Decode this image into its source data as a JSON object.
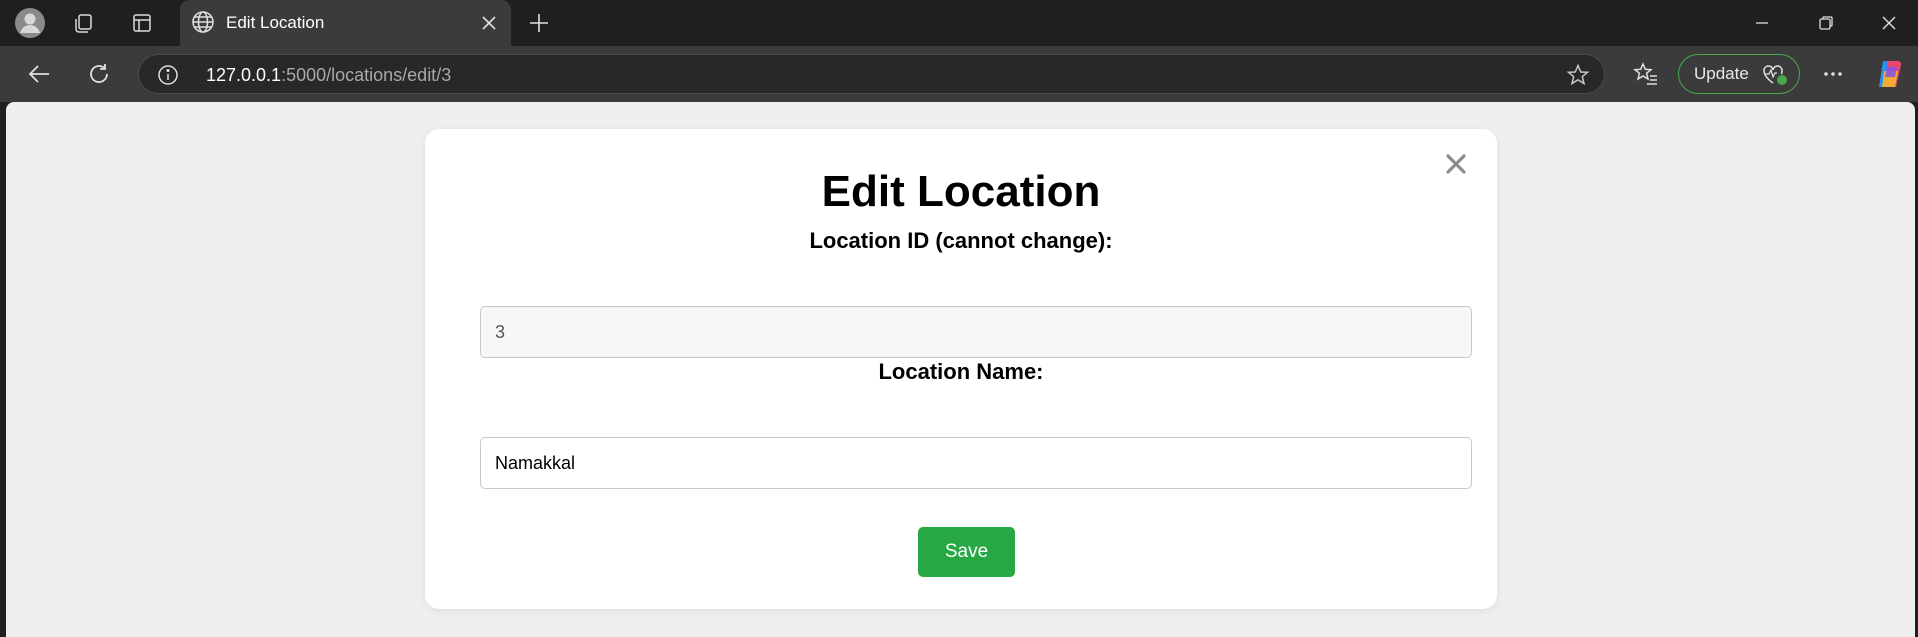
{
  "browser": {
    "tab": {
      "title": "Edit Location"
    },
    "address": {
      "host": "127.0.0.1",
      "path": ":5000/locations/edit/3"
    },
    "update_label": "Update",
    "icons": [
      "profile-icon",
      "workspaces-icon",
      "tab-actions-icon",
      "globe-icon",
      "close-icon",
      "new-tab-icon",
      "minimize-icon",
      "restore-icon",
      "window-close-icon",
      "back-icon",
      "refresh-icon",
      "info-icon",
      "favorite-star-icon",
      "favorites-icon",
      "health-icon",
      "more-icon",
      "copilot-icon"
    ],
    "accent": "#4aa84a"
  },
  "form": {
    "title": "Edit Location",
    "id_label": "Location ID (cannot change):",
    "id_value": "3",
    "name_label": "Location Name:",
    "name_value": "Namakkal",
    "save_label": "Save",
    "save_color": "#28a745"
  }
}
